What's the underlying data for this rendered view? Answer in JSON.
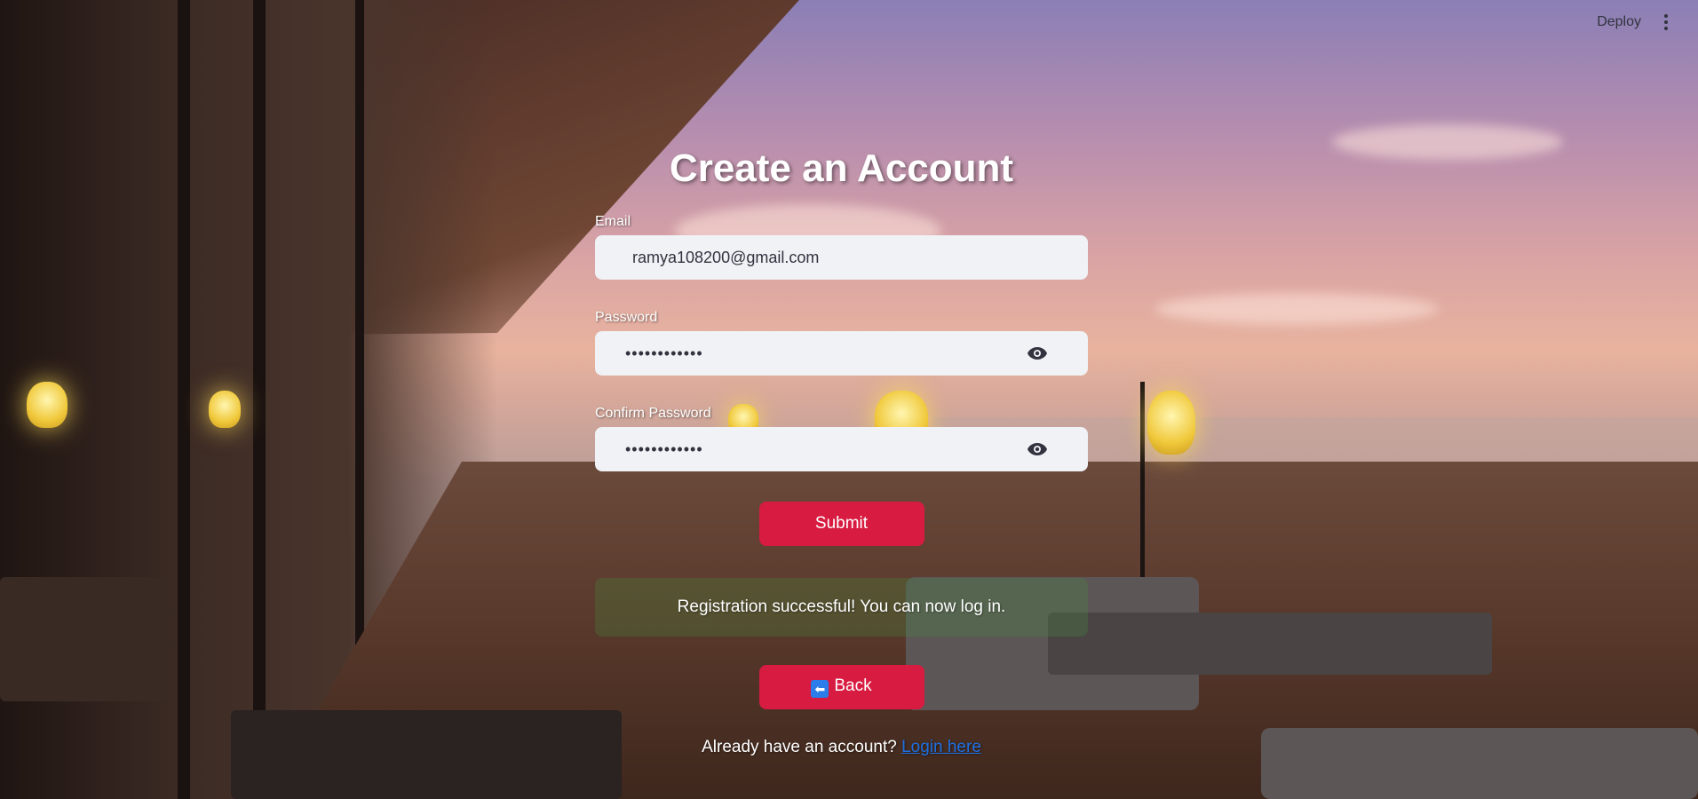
{
  "topbar": {
    "deploy_label": "Deploy",
    "menu_icon": "kebab-menu-icon"
  },
  "form": {
    "title": "Create an Account",
    "email": {
      "label": "Email",
      "value": "ramya108200@gmail.com"
    },
    "password": {
      "label": "Password",
      "value": "••••••••••••",
      "toggle_icon": "eye-icon"
    },
    "confirm_password": {
      "label": "Confirm Password",
      "value": "••••••••••••",
      "toggle_icon": "eye-icon"
    },
    "submit_label": "Submit",
    "success_message": "Registration successful! You can now log in.",
    "back_icon": "⬅",
    "back_label": "Back",
    "footer_text": "Already have an account?",
    "login_link": "Login here"
  },
  "colors": {
    "accent": "#d81b40",
    "input_bg": "#f0f2f6",
    "link": "#1e6fe0"
  }
}
